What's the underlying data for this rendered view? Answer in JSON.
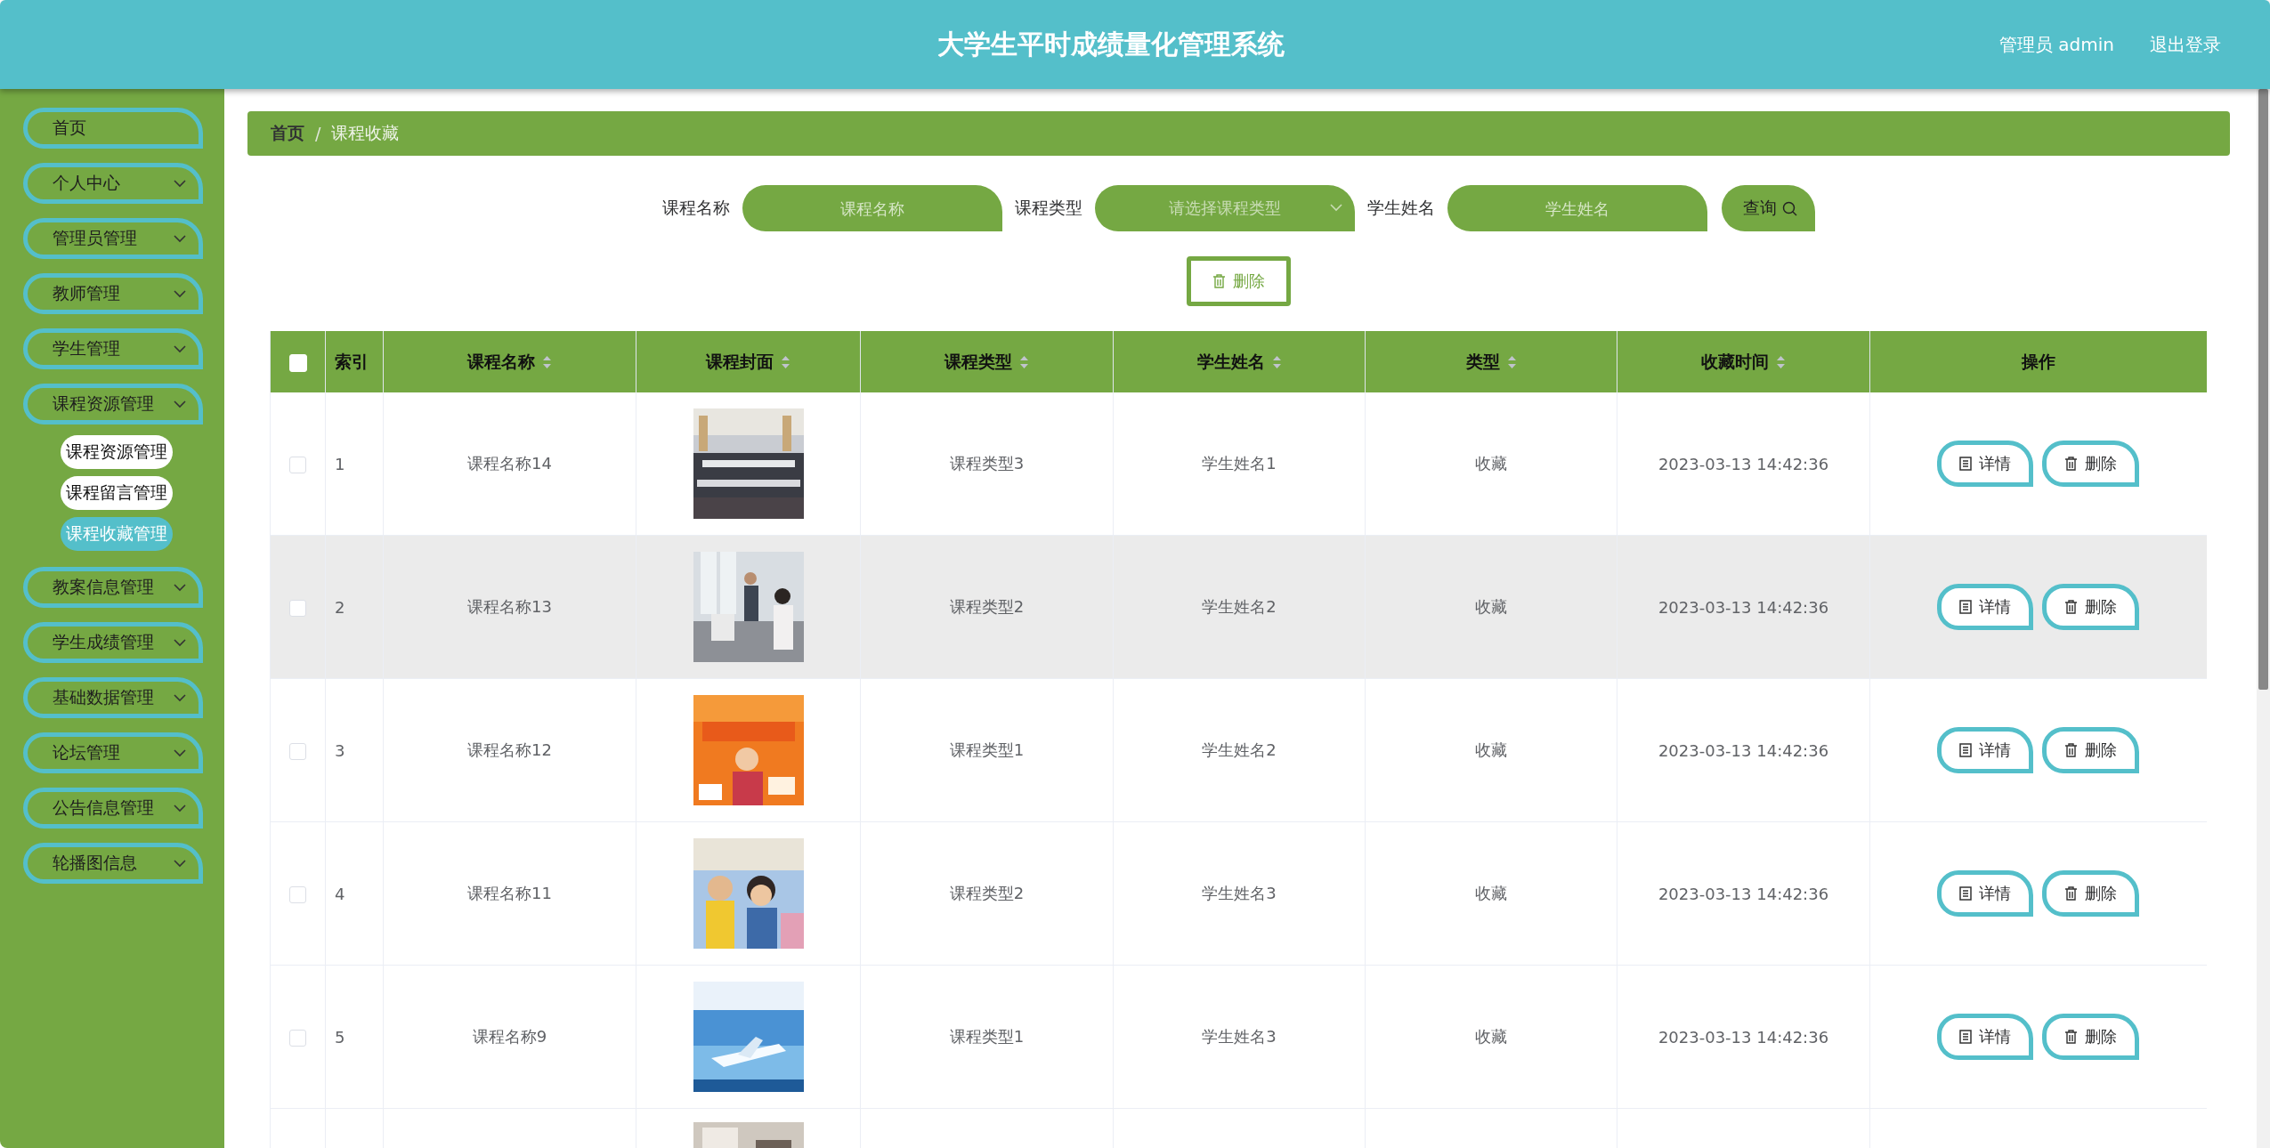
{
  "header": {
    "title": "大学生平时成绩量化管理系统",
    "user": "管理员 admin",
    "logout": "退出登录"
  },
  "sidebar": {
    "items": [
      {
        "label": "首页",
        "expandable": false
      },
      {
        "label": "个人中心",
        "expandable": true
      },
      {
        "label": "管理员管理",
        "expandable": true
      },
      {
        "label": "教师管理",
        "expandable": true
      },
      {
        "label": "学生管理",
        "expandable": true
      },
      {
        "label": "课程资源管理",
        "expandable": true,
        "expanded": true,
        "children": [
          {
            "label": "课程资源管理",
            "selected": false
          },
          {
            "label": "课程留言管理",
            "selected": false
          },
          {
            "label": "课程收藏管理",
            "selected": true
          }
        ]
      },
      {
        "label": "教案信息管理",
        "expandable": true
      },
      {
        "label": "学生成绩管理",
        "expandable": true
      },
      {
        "label": "基础数据管理",
        "expandable": true
      },
      {
        "label": "论坛管理",
        "expandable": true
      },
      {
        "label": "公告信息管理",
        "expandable": true
      },
      {
        "label": "轮播图信息",
        "expandable": true
      }
    ]
  },
  "breadcrumb": {
    "separator": "/",
    "items": [
      "首页",
      "课程收藏"
    ]
  },
  "filters": [
    {
      "label": "课程名称",
      "kind": "text",
      "placeholder": "课程名称"
    },
    {
      "label": "课程类型",
      "kind": "select",
      "placeholder": "请选择课程类型"
    },
    {
      "label": "学生姓名",
      "kind": "text",
      "placeholder": "学生姓名"
    }
  ],
  "search_button": "查询",
  "delete_button": "删除",
  "table": {
    "columns": [
      {
        "kind": "checkbox",
        "checked": false
      },
      {
        "kind": "text",
        "label": "索引",
        "sortable": false
      },
      {
        "kind": "text",
        "label": "课程名称",
        "sortable": true
      },
      {
        "kind": "text",
        "label": "课程封面",
        "sortable": true
      },
      {
        "kind": "text",
        "label": "课程类型",
        "sortable": true
      },
      {
        "kind": "text",
        "label": "学生姓名",
        "sortable": true
      },
      {
        "kind": "text",
        "label": "类型",
        "sortable": true
      },
      {
        "kind": "text",
        "label": "收藏时间",
        "sortable": true
      },
      {
        "kind": "text",
        "label": "操作",
        "sortable": false
      }
    ],
    "rows": [
      {
        "checked": false,
        "highlighted": false,
        "index": "1",
        "course": "课程名称14",
        "cover": {
          "kind": "picture"
        },
        "course_type": "课程类型3",
        "student": "学生姓名1",
        "type": "收藏",
        "time": "2023-03-13 14:42:36",
        "actions": [
          "详情",
          "删除"
        ]
      },
      {
        "checked": false,
        "highlighted": true,
        "index": "2",
        "course": "课程名称13",
        "cover": {
          "kind": "picture"
        },
        "course_type": "课程类型2",
        "student": "学生姓名2",
        "type": "收藏",
        "time": "2023-03-13 14:42:36",
        "actions": [
          "详情",
          "删除"
        ]
      },
      {
        "checked": false,
        "highlighted": false,
        "index": "3",
        "course": "课程名称12",
        "cover": {
          "kind": "picture"
        },
        "course_type": "课程类型1",
        "student": "学生姓名2",
        "type": "收藏",
        "time": "2023-03-13 14:42:36",
        "actions": [
          "详情",
          "删除"
        ]
      },
      {
        "checked": false,
        "highlighted": false,
        "index": "4",
        "course": "课程名称11",
        "cover": {
          "kind": "picture"
        },
        "course_type": "课程类型2",
        "student": "学生姓名3",
        "type": "收藏",
        "time": "2023-03-13 14:42:36",
        "actions": [
          "详情",
          "删除"
        ]
      },
      {
        "checked": false,
        "highlighted": false,
        "index": "5",
        "course": "课程名称9",
        "cover": {
          "kind": "picture"
        },
        "course_type": "课程类型1",
        "student": "学生姓名3",
        "type": "收藏",
        "time": "2023-03-13 14:42:36",
        "actions": [
          "详情",
          "删除"
        ]
      },
      {
        "cover": {
          "kind": "picture"
        }
      }
    ]
  }
}
